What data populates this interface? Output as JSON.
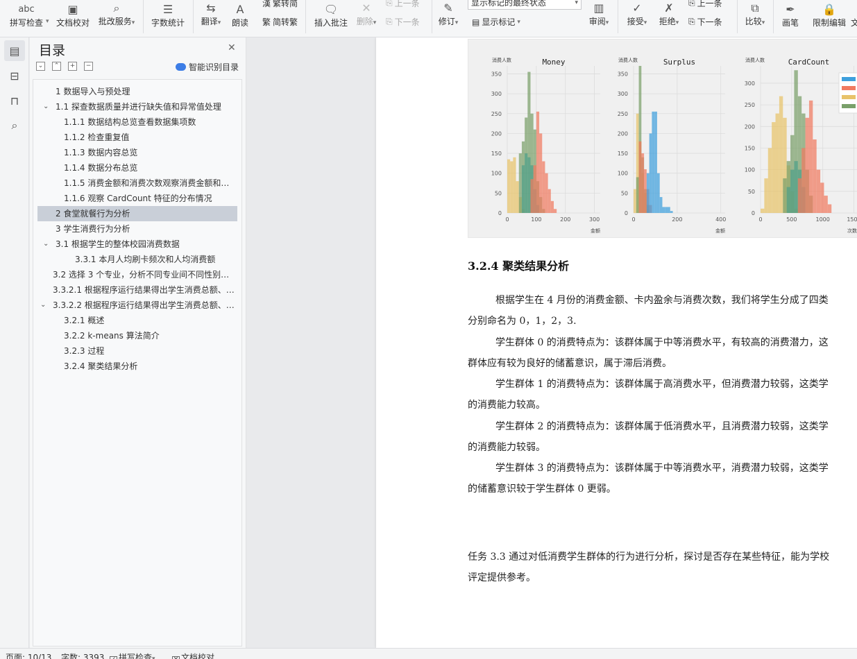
{
  "ribbon": {
    "spell_check": {
      "label": "拼写检查",
      "glyph": "abc"
    },
    "doc_proof": {
      "label": "文档校对"
    },
    "review_service": {
      "label": "批改服务"
    },
    "word_count": {
      "label": "字数统计"
    },
    "translate": {
      "label": "翻译"
    },
    "read_aloud": {
      "label": "朗读"
    },
    "trad_to_simp": {
      "label": "繁转简"
    },
    "simp_to_trad": {
      "label": "简转繁"
    },
    "insert_comment": {
      "label": "插入批注"
    },
    "delete": {
      "label": "删除"
    },
    "prev_comment": {
      "label": "上一条"
    },
    "next_comment": {
      "label": "下一条"
    },
    "track_changes": {
      "label": "修订"
    },
    "markup_select": {
      "value": "显示标记的最终状态"
    },
    "show_markup": {
      "label": "显示标记"
    },
    "review_pane": {
      "label": "审阅"
    },
    "accept": {
      "label": "接受"
    },
    "reject": {
      "label": "拒绝"
    },
    "prev_change": {
      "label": "上一条"
    },
    "next_change": {
      "label": "下一条"
    },
    "compare": {
      "label": "比较"
    },
    "pen": {
      "label": "画笔"
    },
    "restrict_edit": {
      "label": "限制编辑"
    },
    "more": {
      "label": "文"
    }
  },
  "toc": {
    "title": "目录",
    "smart_label": "智能识别目录",
    "items": [
      {
        "text": "1 数据导入与预处理",
        "level": 0,
        "chevron": false,
        "selected": false
      },
      {
        "text": "1.1 探查数据质量并进行缺失值和异常值处理",
        "level": 0,
        "chevron": true,
        "selected": false
      },
      {
        "text": "1.1.1 数据结构总览查看数据集项数",
        "level": 1,
        "chevron": false,
        "selected": false
      },
      {
        "text": "1.1.2 检查重复值",
        "level": 1,
        "chevron": false,
        "selected": false
      },
      {
        "text": "1.1.3 数据内容总览",
        "level": 1,
        "chevron": false,
        "selected": false
      },
      {
        "text": "1.1.4 数据分布总览",
        "level": 1,
        "chevron": false,
        "selected": false
      },
      {
        "text": "1.1.5 消费金额和消费次数观察消费金额和…",
        "level": 1,
        "chevron": false,
        "selected": false
      },
      {
        "text": "1.1.6 观察 CardCount 特征的分布情况",
        "level": 1,
        "chevron": false,
        "selected": false
      },
      {
        "text": "2 食堂就餐行为分析",
        "level": 0,
        "chevron": false,
        "selected": true
      },
      {
        "text": "3 学生消费行为分析",
        "level": 0,
        "chevron": false,
        "selected": false
      },
      {
        "text": "3.1 根据学生的整体校园消费数据",
        "level": 0,
        "chevron": true,
        "selected": false
      },
      {
        "text": "3.3.1 本月人均刷卡频次和人均消费额",
        "level": 2,
        "chevron": false,
        "selected": false
      },
      {
        "text": "3.2 选择 3 个专业，分析不同专业间不同性别…",
        "level": -1,
        "chevron": false,
        "selected": false
      },
      {
        "text": "3.3.2.1 根据程序运行结果得出学生消费总额、…",
        "level": -1,
        "chevron": false,
        "selected": false
      },
      {
        "text": "3.3.2.2 根据程序运行结果得出学生消费总额、…",
        "level": -1,
        "chevron": true,
        "selected": false
      },
      {
        "text": "3.2.1 概述",
        "level": 1,
        "chevron": false,
        "selected": false
      },
      {
        "text": "3.2.2 k-means 算法简介",
        "level": 1,
        "chevron": false,
        "selected": false
      },
      {
        "text": "3.2.3 过程",
        "level": 1,
        "chevron": false,
        "selected": false
      },
      {
        "text": "3.2.4 聚类结果分析",
        "level": 1,
        "chevron": false,
        "selected": false
      }
    ]
  },
  "document": {
    "heading": "3.2.4 聚类结果分析",
    "paragraphs": [
      "根据学生在 4 月份的消费金额、卡内盈余与消费次数，我们将学生分成了四类",
      "分别命名为 0，1，2，3.",
      "学生群体 0 的消费特点为：该群体属于中等消费水平，有较高的消费潜力，这",
      "群体应有较为良好的储蓄意识，属于滞后消费。",
      "学生群体 1 的消费特点为：该群体属于高消费水平，但消费潜力较弱，这类学",
      "的消费能力较高。",
      "学生群体 2 的消费特点为：该群体属于低消费水平，且消费潜力较弱，这类学",
      "的消费能力较弱。",
      "学生群体 3 的消费特点为：该群体属于中等消费水平，消费潜力较弱，这类学",
      "的储蓄意识较于学生群体 0 更弱。",
      "任务 3.3 通过对低消费学生群体的行为进行分析，探讨是否存在某些特征，能为学校",
      "评定提供参考。"
    ]
  },
  "chart_data": [
    {
      "type": "bar",
      "title": "Money",
      "ylabel": "消费人数",
      "xlabel": "金额",
      "xlim": [
        0,
        320
      ],
      "ylim": [
        0,
        370
      ],
      "yticks": [
        0,
        50,
        100,
        150,
        200,
        250,
        300,
        350
      ],
      "xticks": [
        0,
        100,
        200,
        300
      ],
      "bin_width": 10,
      "series": [
        {
          "color": "#e8c36a",
          "start": 0,
          "values": [
            135,
            130,
            140,
            80,
            40,
            10
          ]
        },
        {
          "color": "#7aa06a",
          "start": 40,
          "values": [
            150,
            180,
            240,
            355,
            250,
            210,
            80,
            40,
            10
          ]
        },
        {
          "color": "#4f9f88",
          "start": 50,
          "values": [
            120,
            150,
            140,
            120,
            60,
            20
          ]
        },
        {
          "color": "#f07a60",
          "start": 80,
          "values": [
            85,
            120,
            255,
            200,
            130,
            100,
            60,
            30,
            10
          ]
        }
      ]
    },
    {
      "type": "bar",
      "title": "Surplus",
      "ylabel": "消费人数",
      "xlabel": "金额",
      "xlim": [
        0,
        420
      ],
      "ylim": [
        0,
        370
      ],
      "yticks": [
        0,
        50,
        100,
        150,
        200,
        250,
        300,
        350
      ],
      "xticks": [
        0,
        200,
        400
      ],
      "bin_width": 12,
      "series": [
        {
          "color": "#e8c36a",
          "start": 0,
          "values": [
            60,
            250,
            180,
            100,
            50,
            10
          ]
        },
        {
          "color": "#7aa06a",
          "start": 12,
          "values": [
            90,
            370,
            140,
            60,
            20
          ]
        },
        {
          "color": "#f07a60",
          "start": 24,
          "values": [
            180,
            150,
            110,
            60,
            20
          ]
        },
        {
          "color": "#3ea0dd",
          "start": 60,
          "values": [
            100,
            200,
            255,
            255,
            100,
            40,
            15,
            15,
            15,
            5
          ]
        }
      ]
    },
    {
      "type": "bar",
      "title": "CardCount",
      "ylabel": "消费人数",
      "xlabel": "次数",
      "xlim": [
        0,
        1550
      ],
      "ylim": [
        0,
        340
      ],
      "yticks": [
        0,
        50,
        100,
        150,
        200,
        250,
        300
      ],
      "xticks": [
        0,
        500,
        1000,
        1500
      ],
      "bin_width": 60,
      "series": [
        {
          "color": "#e8c36a",
          "start": 0,
          "values": [
            10,
            80,
            150,
            210,
            230,
            270,
            220,
            110,
            50,
            10
          ]
        },
        {
          "color": "#7aa06a",
          "start": 360,
          "values": [
            80,
            120,
            180,
            330,
            270,
            230,
            100,
            40
          ]
        },
        {
          "color": "#4f9f88",
          "start": 420,
          "values": [
            60,
            100,
            120,
            100,
            60
          ]
        },
        {
          "color": "#f07a60",
          "start": 600,
          "values": [
            80,
            150,
            220,
            260,
            170,
            100,
            70,
            40,
            20
          ]
        }
      ]
    }
  ],
  "status": {
    "page": "页面: 10/13",
    "words": "字数: 3393",
    "spell": "拼写检查",
    "proof": "文档校对"
  }
}
